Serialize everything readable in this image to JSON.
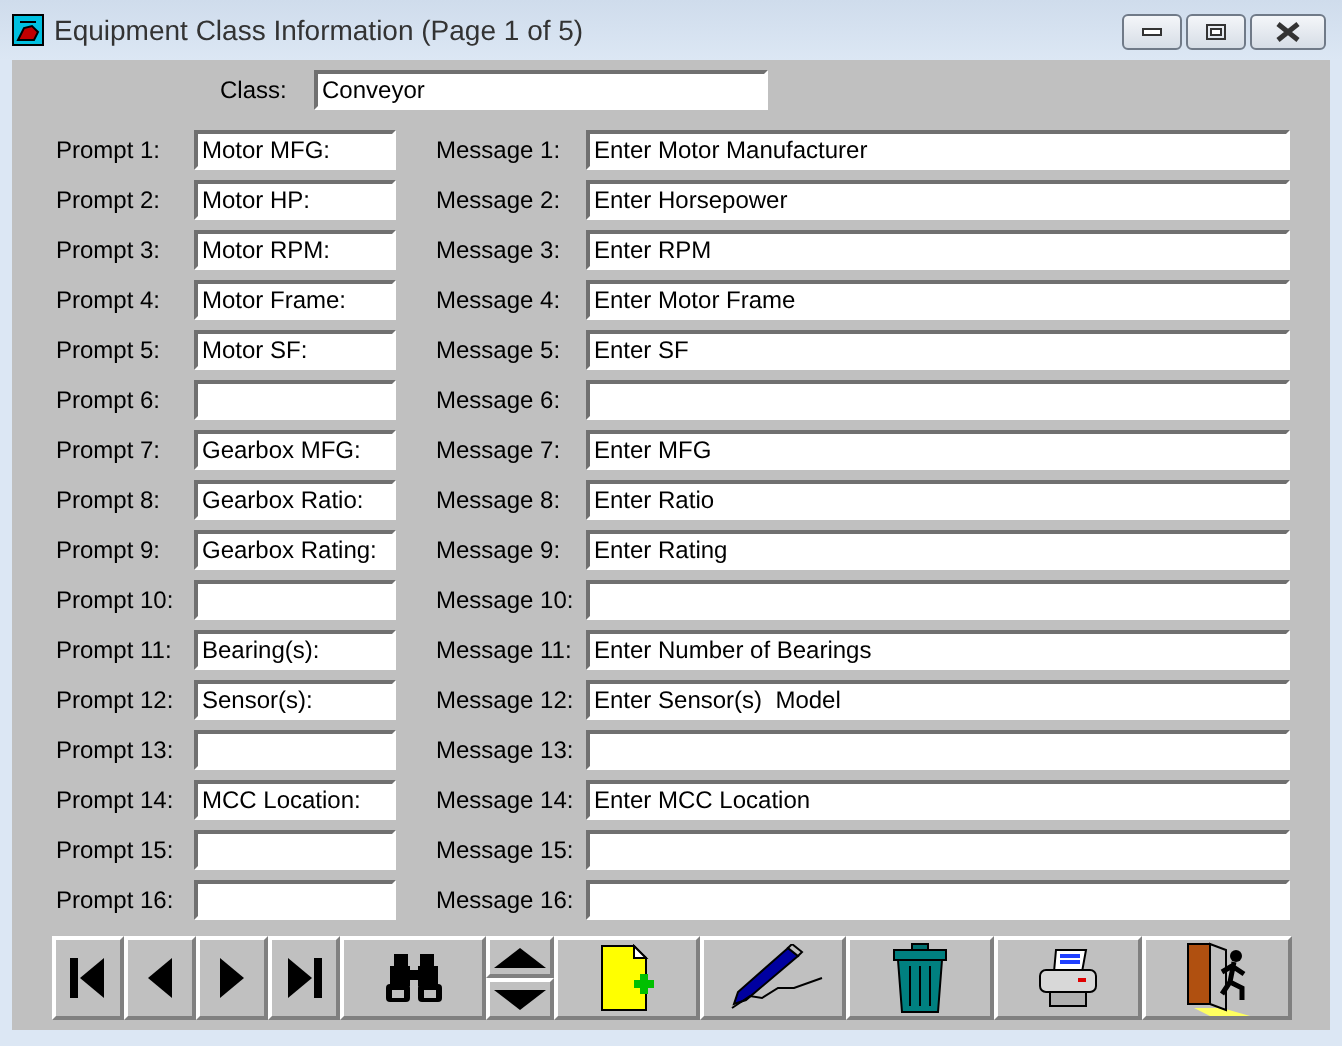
{
  "window": {
    "title": "Equipment Class Information (Page 1 of 5)"
  },
  "class": {
    "label": "Class:",
    "value": "Conveyor"
  },
  "rows": [
    {
      "prompt_label": "Prompt 1:",
      "prompt_value": "Motor MFG:",
      "message_label": "Message 1:",
      "message_value": "Enter Motor Manufacturer"
    },
    {
      "prompt_label": "Prompt 2:",
      "prompt_value": "Motor HP:",
      "message_label": "Message 2:",
      "message_value": "Enter Horsepower"
    },
    {
      "prompt_label": "Prompt 3:",
      "prompt_value": "Motor RPM:",
      "message_label": "Message 3:",
      "message_value": "Enter RPM"
    },
    {
      "prompt_label": "Prompt 4:",
      "prompt_value": "Motor Frame:",
      "message_label": "Message 4:",
      "message_value": "Enter Motor Frame"
    },
    {
      "prompt_label": "Prompt 5:",
      "prompt_value": "Motor SF:",
      "message_label": "Message 5:",
      "message_value": "Enter SF"
    },
    {
      "prompt_label": "Prompt 6:",
      "message_label": "Message 6:"
    },
    {
      "prompt_label": "Prompt 7:",
      "prompt_value": "Gearbox MFG:",
      "message_label": "Message 7:",
      "message_value": "Enter MFG"
    },
    {
      "prompt_label": "Prompt 8:",
      "prompt_value": "Gearbox Ratio:",
      "message_label": "Message 8:",
      "message_value": "Enter Ratio"
    },
    {
      "prompt_label": "Prompt 9:",
      "prompt_value": "Gearbox Rating:",
      "message_label": "Message 9:",
      "message_value": "Enter Rating"
    },
    {
      "prompt_label": "Prompt 10:",
      "message_label": "Message 10:"
    },
    {
      "prompt_label": "Prompt 11:",
      "prompt_value": "Bearing(s):",
      "message_label": "Message 11:",
      "message_value": "Enter Number of Bearings"
    },
    {
      "prompt_label": "Prompt 12:",
      "prompt_value": "Sensor(s):",
      "message_label": "Message 12:",
      "message_value": "Enter Sensor(s)  Model"
    },
    {
      "prompt_label": "Prompt 13:",
      "message_label": "Message 13:"
    },
    {
      "prompt_label": "Prompt 14:",
      "prompt_value": "MCC Location:",
      "message_label": "Message 14:",
      "message_value": "Enter MCC Location"
    },
    {
      "prompt_label": "Prompt 15:",
      "message_label": "Message 15:"
    },
    {
      "prompt_label": "Prompt 16:",
      "message_label": "Message 16:"
    }
  ],
  "toolbar": [
    {
      "kind": "first"
    },
    {
      "kind": "previous"
    },
    {
      "kind": "next"
    },
    {
      "kind": "last"
    },
    {
      "kind": "find"
    },
    {
      "kind": "updown"
    },
    {
      "kind": "new"
    },
    {
      "kind": "edit"
    },
    {
      "kind": "delete"
    },
    {
      "kind": "print"
    },
    {
      "kind": "exit"
    }
  ]
}
